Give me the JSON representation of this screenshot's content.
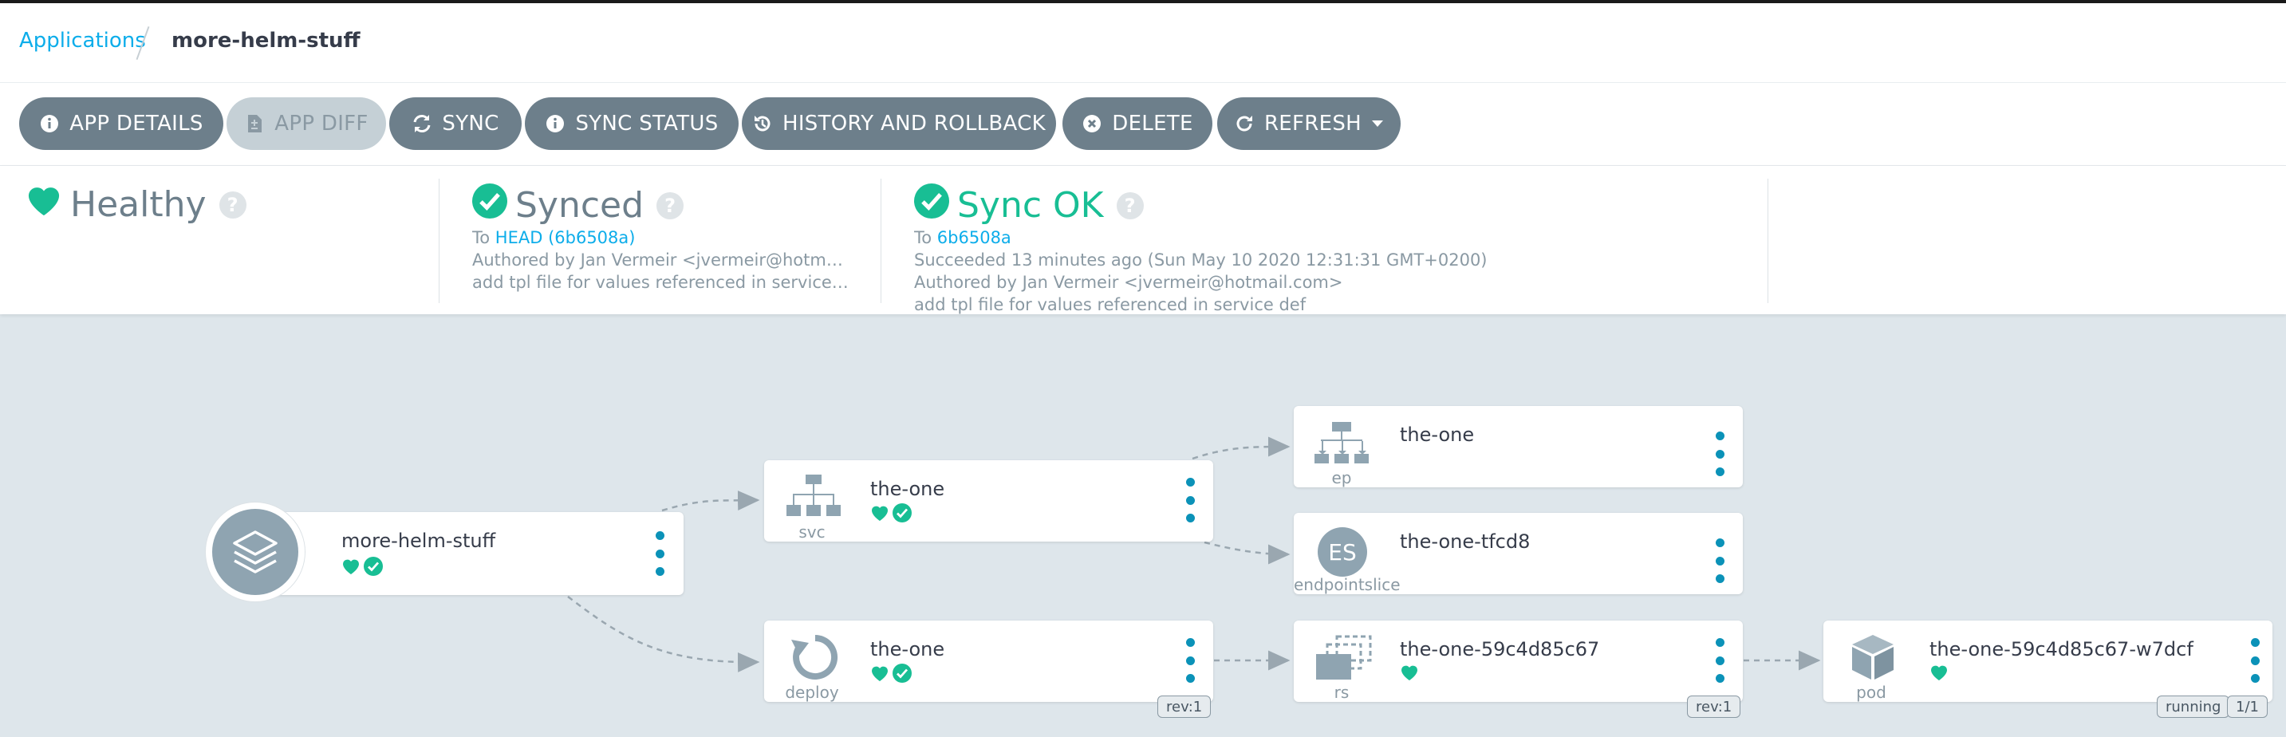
{
  "breadcrumb": {
    "root": "Applications",
    "current": "more-helm-stuff"
  },
  "toolbar": {
    "app_details": "APP DETAILS",
    "app_diff": "APP DIFF",
    "sync": "SYNC",
    "sync_status": "SYNC STATUS",
    "history": "HISTORY AND ROLLBACK",
    "delete": "DELETE",
    "refresh": "REFRESH"
  },
  "status": {
    "health": {
      "label": "Healthy"
    },
    "sync": {
      "label": "Synced",
      "to_prefix": "To",
      "revision": "HEAD (6b6508a)",
      "author": "Authored by Jan Vermeir <jvermeir@hotmail.c...",
      "message": "add tpl file for values referenced in service def"
    },
    "operation": {
      "label": "Sync OK",
      "to_prefix": "To",
      "revision": "6b6508a",
      "succeeded": "Succeeded 13 minutes ago (Sun May 10 2020 12:31:31 GMT+0200)",
      "author": "Authored by Jan Vermeir <jvermeir@hotmail.com>",
      "message": "add tpl file for values referenced in service def"
    }
  },
  "colors": {
    "accent": "#0dadea",
    "healthy": "#18be94",
    "button": "#6d7f8b",
    "canvas": "#dee6eb"
  },
  "tree": {
    "app": {
      "name": "more-helm-stuff"
    },
    "svc": {
      "name": "the-one",
      "kind": "svc"
    },
    "deploy": {
      "name": "the-one",
      "kind": "deploy",
      "tag": "rev:1"
    },
    "ep": {
      "name": "the-one",
      "kind": "ep"
    },
    "endpointslice": {
      "name": "the-one-tfcd8",
      "kind": "endpointslice",
      "icon_text": "ES"
    },
    "rs": {
      "name": "the-one-59c4d85c67",
      "kind": "rs",
      "tag": "rev:1"
    },
    "pod": {
      "name": "the-one-59c4d85c67-w7dcf",
      "kind": "pod",
      "tag_status": "running",
      "tag_count": "1/1"
    }
  }
}
